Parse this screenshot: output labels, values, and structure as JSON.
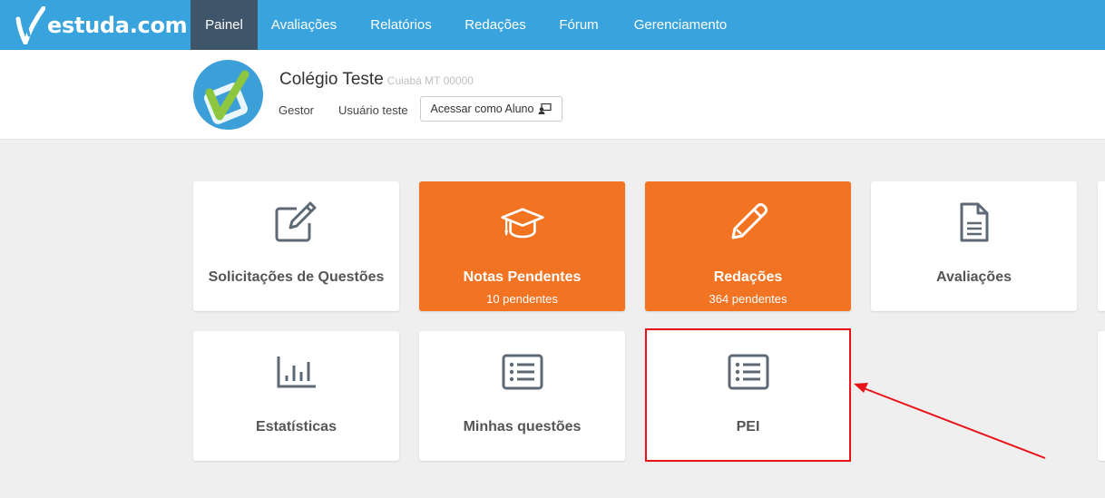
{
  "brand": {
    "logo_text": "estuda.com",
    "nav_bg": "#38a3dc",
    "nav_active_bg": "#3f5569",
    "accent_orange": "#f27322",
    "highlight_red": "#e8141a"
  },
  "nav": {
    "items": [
      {
        "label": "Painel",
        "active": true
      },
      {
        "label": "Avaliações"
      },
      {
        "label": "Relatórios"
      },
      {
        "label": "Redações"
      },
      {
        "label": "Fórum"
      },
      {
        "label": "Gerenciamento"
      }
    ]
  },
  "school": {
    "name": "Colégio Teste",
    "location": "Cuiabá MT 00000",
    "role": "Gestor",
    "user": "Usuário teste",
    "access_button": "Acessar como Aluno",
    "access_icon": "user-switch-icon"
  },
  "cards": [
    {
      "title": "Solicitações de Questões",
      "subtitle": "",
      "icon": "edit-icon",
      "style": "white"
    },
    {
      "title": "Notas Pendentes",
      "subtitle": "10 pendentes",
      "icon": "graduation-cap-icon",
      "style": "orange"
    },
    {
      "title": "Redações",
      "subtitle": "364 pendentes",
      "icon": "pencil-icon",
      "style": "orange"
    },
    {
      "title": "Avaliações",
      "subtitle": "",
      "icon": "document-icon",
      "style": "white"
    },
    {
      "title": "Estatísticas",
      "subtitle": "",
      "icon": "bar-chart-icon",
      "style": "white"
    },
    {
      "title": "Minhas questões",
      "subtitle": "",
      "icon": "list-icon",
      "style": "white"
    },
    {
      "title": "PEI",
      "subtitle": "",
      "icon": "list-icon",
      "style": "white",
      "highlighted": true
    }
  ]
}
